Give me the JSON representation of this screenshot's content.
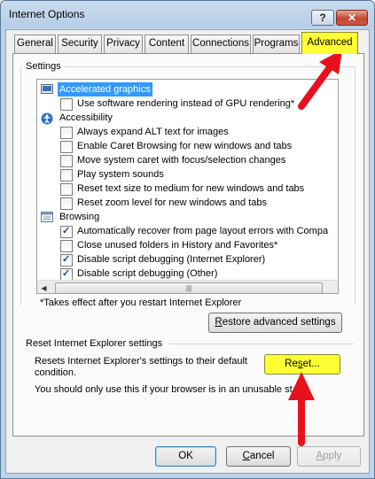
{
  "window": {
    "title": "Internet Options",
    "help_glyph": "?",
    "close_glyph": "✕"
  },
  "tabs": [
    {
      "label": "General"
    },
    {
      "label": "Security"
    },
    {
      "label": "Privacy"
    },
    {
      "label": "Content"
    },
    {
      "label": "Connections"
    },
    {
      "label": "Programs"
    },
    {
      "label": "Advanced"
    }
  ],
  "settings": {
    "group_label": "Settings",
    "items": [
      {
        "type": "category",
        "icon": "display-icon",
        "label": "Accelerated graphics",
        "selected": true
      },
      {
        "type": "checkbox",
        "checked": false,
        "label": "Use software rendering instead of GPU rendering*"
      },
      {
        "type": "category",
        "icon": "accessibility-icon",
        "label": "Accessibility"
      },
      {
        "type": "checkbox",
        "checked": false,
        "label": "Always expand ALT text for images"
      },
      {
        "type": "checkbox",
        "checked": false,
        "label": "Enable Caret Browsing for new windows and tabs"
      },
      {
        "type": "checkbox",
        "checked": false,
        "label": "Move system caret with focus/selection changes"
      },
      {
        "type": "checkbox",
        "checked": false,
        "label": "Play system sounds"
      },
      {
        "type": "checkbox",
        "checked": false,
        "label": "Reset text size to medium for new windows and tabs"
      },
      {
        "type": "checkbox",
        "checked": false,
        "label": "Reset zoom level for new windows and tabs"
      },
      {
        "type": "category",
        "icon": "browsing-icon",
        "label": "Browsing"
      },
      {
        "type": "checkbox",
        "checked": true,
        "label": "Automatically recover from page layout errors with Compa"
      },
      {
        "type": "checkbox",
        "checked": false,
        "label": "Close unused folders in History and Favorites*"
      },
      {
        "type": "checkbox",
        "checked": true,
        "label": "Disable script debugging (Internet Explorer)"
      },
      {
        "type": "checkbox",
        "checked": true,
        "label": "Disable script debugging (Other)"
      }
    ],
    "footnote": "*Takes effect after you restart Internet Explorer",
    "restore_button": "Restore advanced settings",
    "restore_accel": "R",
    "restore_rest": "estore advanced settings"
  },
  "reset_section": {
    "group_label": "Reset Internet Explorer settings",
    "description": "Resets Internet Explorer's settings to their default condition.",
    "warning": "You should only use this if your browser is in an unusable sta",
    "reset_button": "Reset...",
    "reset_accel": "s",
    "reset_pre": "Re",
    "reset_post": "et..."
  },
  "footer": {
    "ok": "OK",
    "cancel": "Cancel",
    "apply": "Apply",
    "apply_accel": "A",
    "apply_rest": "pply",
    "cancel_accel": "C",
    "cancel_rest": "ancel"
  },
  "scroll": {
    "up": "▲",
    "down": "▼",
    "left": "◀",
    "right": "▶",
    "grip": "|||"
  },
  "colors": {
    "highlight": "#ffff33",
    "arrow": "#e8101c",
    "selection": "#3399ff"
  }
}
